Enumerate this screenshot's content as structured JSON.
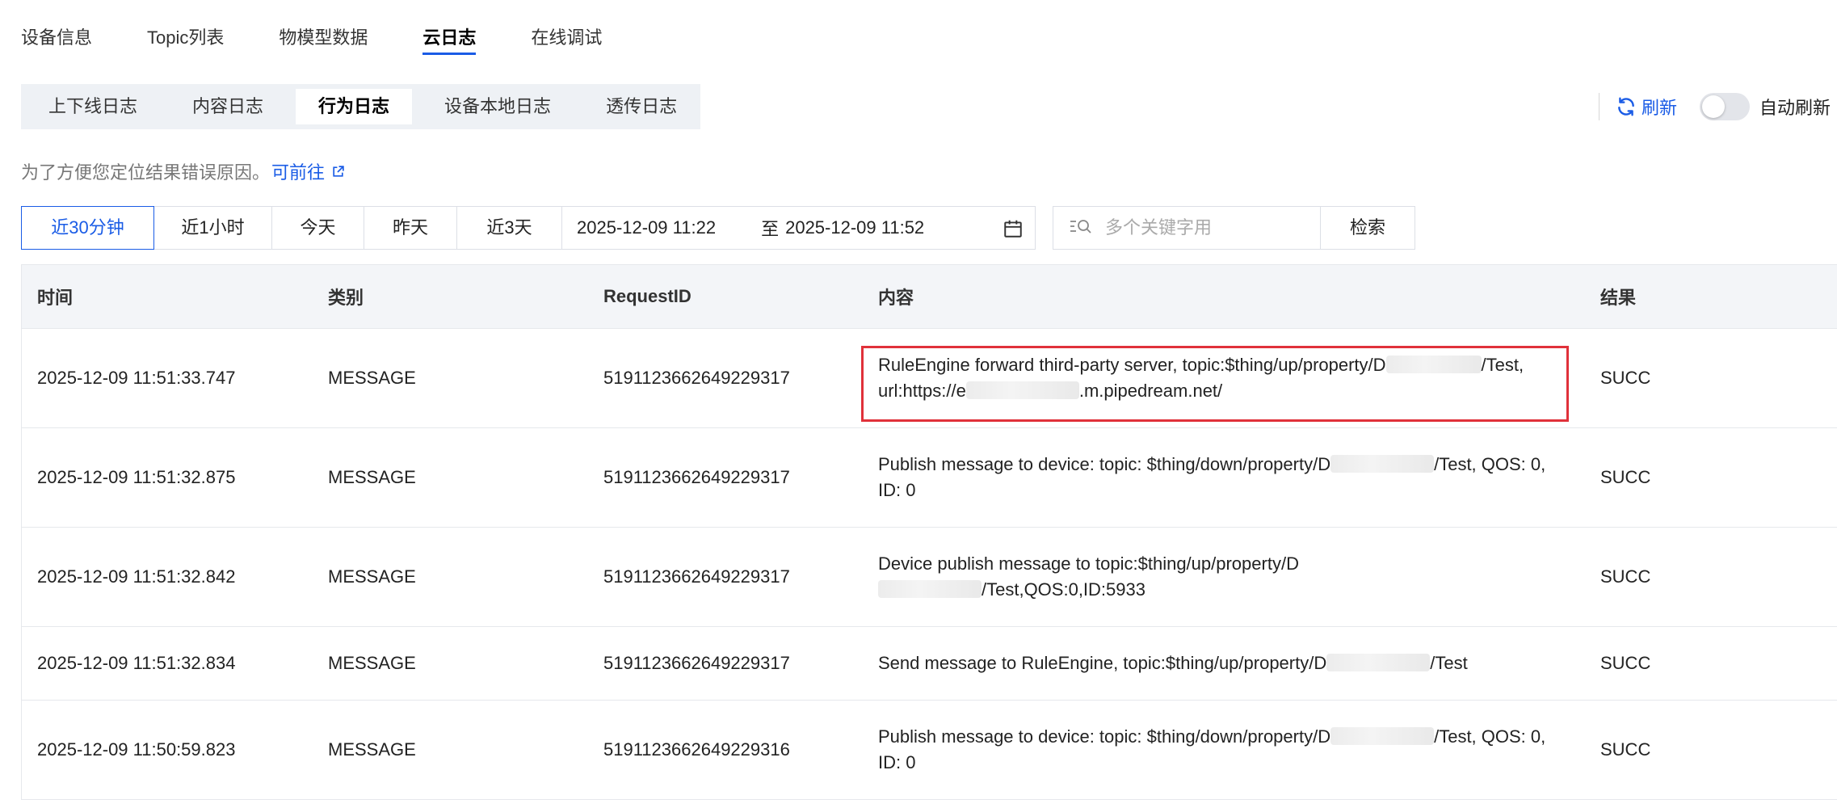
{
  "top_tabs": [
    {
      "label": "设备信息",
      "active": false
    },
    {
      "label": "Topic列表",
      "active": false
    },
    {
      "label": "物模型数据",
      "active": false
    },
    {
      "label": "云日志",
      "active": true
    },
    {
      "label": "在线调试",
      "active": false
    }
  ],
  "sub_tabs": [
    {
      "label": "上下线日志",
      "active": false
    },
    {
      "label": "内容日志",
      "active": false
    },
    {
      "label": "行为日志",
      "active": true
    },
    {
      "label": "设备本地日志",
      "active": false
    },
    {
      "label": "透传日志",
      "active": false
    }
  ],
  "controls": {
    "refresh_label": "刷新",
    "auto_refresh_label": "自动刷新",
    "auto_refresh_on": false
  },
  "hint": {
    "text": "为了方便您定位结果错误原因。",
    "link_label": "可前往"
  },
  "filters": {
    "time_buttons": [
      {
        "label": "近30分钟",
        "active": true
      },
      {
        "label": "近1小时",
        "active": false
      },
      {
        "label": "今天",
        "active": false
      },
      {
        "label": "昨天",
        "active": false
      },
      {
        "label": "近3天",
        "active": false
      }
    ],
    "date_start": "2025-12-09 11:22",
    "date_separator": "至",
    "date_end": "2025-12-09 11:52",
    "search_placeholder": "多个关键字用",
    "search_button": "检索"
  },
  "table": {
    "columns": [
      "时间",
      "类别",
      "RequestID",
      "内容",
      "结果"
    ],
    "rows": [
      {
        "time": "2025-12-09 11:51:33.747",
        "type": "MESSAGE",
        "request_id": "5191123662649229317",
        "content_a": "RuleEngine forward third-party server, topic:$thing/up/property/D",
        "content_b": "/Test, url:https://e",
        "content_c": ".m.pipedream.net/",
        "result": "SUCC",
        "highlighted": true
      },
      {
        "time": "2025-12-09 11:51:32.875",
        "type": "MESSAGE",
        "request_id": "5191123662649229317",
        "content_a": "Publish message to device: topic: $thing/down/property/D",
        "content_b": "/Test, QOS: 0, ID: 0",
        "result": "SUCC"
      },
      {
        "time": "2025-12-09 11:51:32.842",
        "type": "MESSAGE",
        "request_id": "5191123662649229317",
        "content_a": "Device publish message to topic:$thing/up/property/D",
        "content_b": "/Test,QOS:0,ID:5933",
        "result": "SUCC"
      },
      {
        "time": "2025-12-09 11:51:32.834",
        "type": "MESSAGE",
        "request_id": "5191123662649229317",
        "content_a": "Send message to RuleEngine, topic:$thing/up/property/D",
        "content_b": "/Test",
        "result": "SUCC"
      },
      {
        "time": "2025-12-09 11:50:59.823",
        "type": "MESSAGE",
        "request_id": "5191123662649229316",
        "content_a": "Publish message to device: topic: $thing/down/property/D",
        "content_b": "/Test, QOS: 0, ID: 0",
        "result": "SUCC"
      }
    ]
  },
  "colors": {
    "accent": "#1a5ce6",
    "highlight_border": "#e0313a",
    "header_bg": "#f3f5f8"
  },
  "icons": {
    "refresh": "refresh-icon",
    "external_link": "external-link-icon",
    "calendar": "calendar-icon",
    "search": "search-icon"
  }
}
